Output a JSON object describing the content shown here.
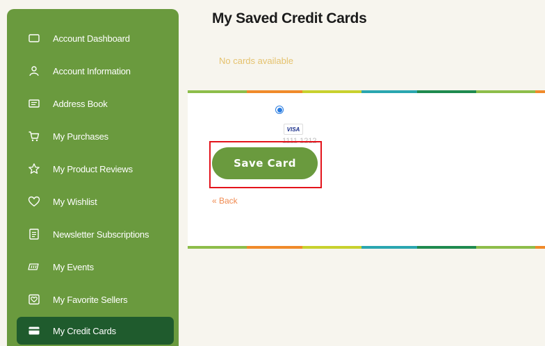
{
  "sidebar": {
    "items": [
      {
        "label": "Account Dashboard",
        "icon": "dashboard-icon"
      },
      {
        "label": "Account Information",
        "icon": "user-icon"
      },
      {
        "label": "Address Book",
        "icon": "address-book-icon"
      },
      {
        "label": "My Purchases",
        "icon": "cart-icon"
      },
      {
        "label": "My Product Reviews",
        "icon": "star-icon"
      },
      {
        "label": "My Wishlist",
        "icon": "heart-icon"
      },
      {
        "label": "Newsletter Subscriptions",
        "icon": "newsletter-icon"
      },
      {
        "label": "My Events",
        "icon": "events-icon"
      },
      {
        "label": "My Favorite Sellers",
        "icon": "favorite-sellers-icon"
      },
      {
        "label": "My Credit Cards",
        "icon": "credit-card-icon",
        "active": true
      }
    ]
  },
  "main": {
    "title": "My Saved Credit Cards",
    "empty_message": "No cards available",
    "card": {
      "selected": true,
      "brand": "VISA",
      "number": "1111 1212"
    },
    "save_button_label": "Save Card",
    "back_link_label": "« Back"
  },
  "colors": {
    "brand_green": "#6a9a3e",
    "active_green": "#1f5b2d",
    "empty_text": "#e5c26e",
    "back_link": "#f08a50",
    "highlight": "#e3131b"
  }
}
